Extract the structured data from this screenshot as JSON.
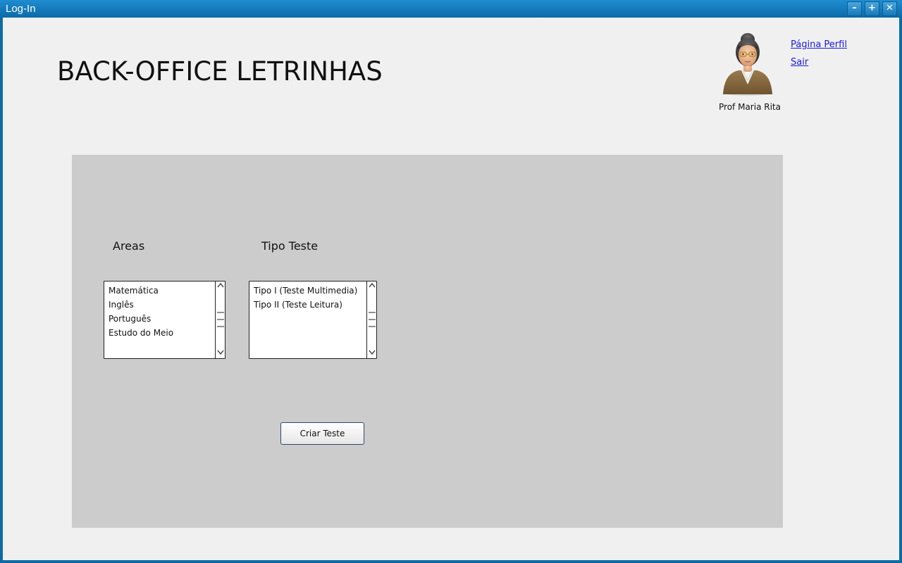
{
  "window": {
    "title": "Log-In",
    "controls": [
      "–",
      "+",
      "✕"
    ]
  },
  "header": {
    "app_title": "BACK-OFFICE LETRINHAS",
    "user_name": "Prof Maria Rita",
    "avatar_icon": "teacher-avatar-icon",
    "profile_link": "Página Perfil",
    "logout_link": "Sair"
  },
  "form": {
    "areas_label": "Areas",
    "areas_items": [
      "Matemática",
      "Inglês",
      "Português",
      "Estudo do Meio"
    ],
    "tipo_label": "Tipo Teste",
    "tipo_items": [
      "Tipo I (Teste Multimedia)",
      "Tipo II (Teste Leitura)"
    ],
    "create_button": "Criar Teste"
  },
  "colors": {
    "titlebar": "#0e6aa3",
    "background": "#f0f0f0",
    "panel": "#cccccc",
    "link": "#1a1ae0"
  }
}
